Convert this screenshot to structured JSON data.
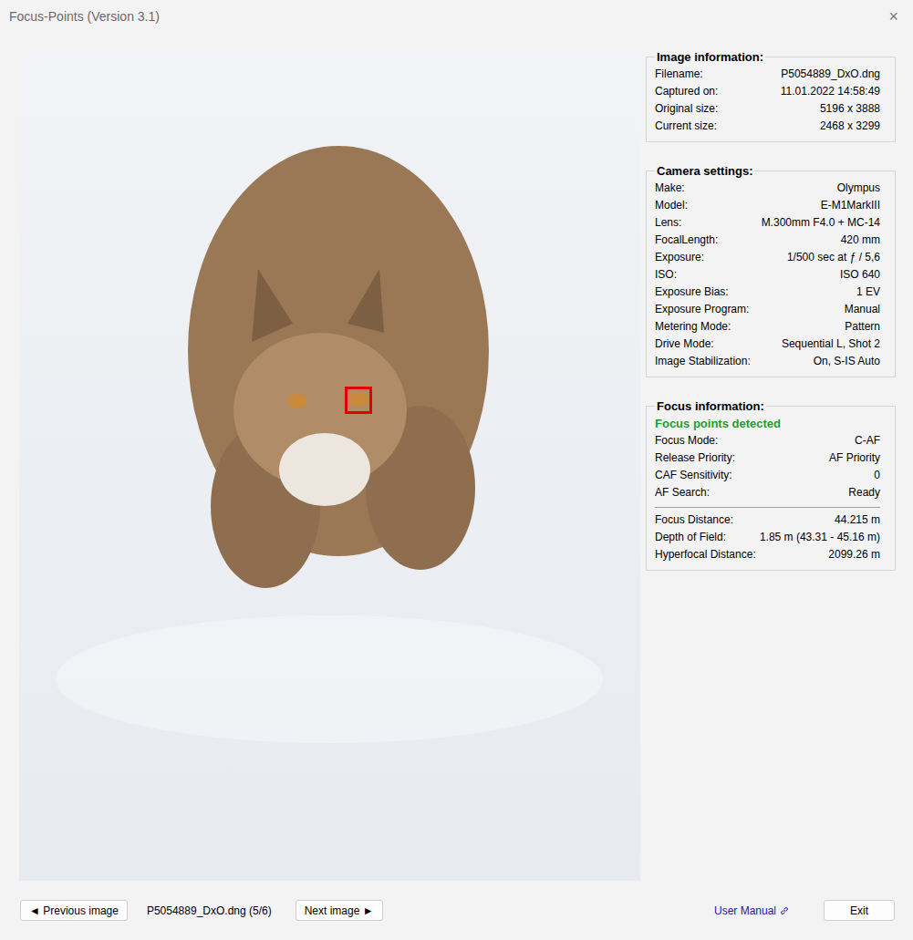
{
  "window": {
    "title": "Focus-Points (Version 3.1)",
    "close": "×"
  },
  "groups": [
    {
      "title": "Image information:",
      "status": "",
      "sections": [
        [
          {
            "label": "Filename:",
            "value": "P5054889_DxO.dng"
          },
          {
            "label": "Captured on:",
            "value": "11.01.2022 14:58:49"
          },
          {
            "label": "Original size:",
            "value": "5196 x 3888"
          },
          {
            "label": "Current size:",
            "value": "2468 x 3299"
          }
        ]
      ]
    },
    {
      "title": "Camera settings:",
      "status": "",
      "sections": [
        [
          {
            "label": "Make:",
            "value": "Olympus"
          },
          {
            "label": "Model:",
            "value": "E-M1MarkIII"
          },
          {
            "label": "Lens:",
            "value": "M.300mm F4.0 + MC-14"
          },
          {
            "label": "FocalLength:",
            "value": "420 mm"
          },
          {
            "label": "Exposure:",
            "value": "1/500 sec at ƒ / 5,6"
          },
          {
            "label": "ISO:",
            "value": "ISO 640"
          },
          {
            "label": "Exposure Bias:",
            "value": "1 EV"
          },
          {
            "label": "Exposure Program:",
            "value": "Manual"
          },
          {
            "label": "Metering Mode:",
            "value": "Pattern"
          },
          {
            "label": "Drive Mode:",
            "value": "Sequential L, Shot 2"
          },
          {
            "label": "Image Stabilization:",
            "value": "On, S-IS Auto"
          }
        ]
      ]
    },
    {
      "title": "Focus information:",
      "status": "Focus points detected",
      "sections": [
        [
          {
            "label": "Focus Mode:",
            "value": "C-AF"
          },
          {
            "label": "Release Priority:",
            "value": "AF Priority"
          },
          {
            "label": "CAF Sensitivity:",
            "value": "0"
          },
          {
            "label": "AF Search:",
            "value": "Ready"
          }
        ],
        [
          {
            "label": "Focus Distance:",
            "value": "44.215 m"
          },
          {
            "label": "Depth of Field:",
            "value": "1.85 m (43.31 - 45.16 m)"
          },
          {
            "label": "Hyperfocal Distance:",
            "value": "2099.26 m"
          }
        ]
      ]
    }
  ],
  "bottom_bar": {
    "previous": "◄ Previous image",
    "file": "P5054889_DxO.dng (5/6)",
    "next": "Next image ►",
    "manual": "User Manual",
    "exit": "Exit"
  }
}
